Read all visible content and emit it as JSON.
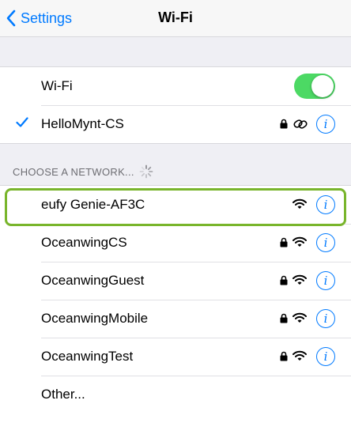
{
  "navbar": {
    "back_label": "Settings",
    "title": "Wi-Fi"
  },
  "wifi_toggle": {
    "label": "Wi-Fi",
    "on": true
  },
  "connected_network": {
    "name": "HelloMynt-CS",
    "icons": [
      "checkmark-icon",
      "lock-icon",
      "link-icon",
      "info-icon"
    ]
  },
  "networks_section": {
    "header": "CHOOSE A NETWORK...",
    "networks": [
      {
        "name": "eufy Genie-AF3C",
        "secured": false,
        "highlighted": true
      },
      {
        "name": "OceanwingCS",
        "secured": true
      },
      {
        "name": "OceanwingGuest",
        "secured": true
      },
      {
        "name": "OceanwingMobile",
        "secured": true
      },
      {
        "name": "OceanwingTest",
        "secured": true
      }
    ],
    "other_label": "Other..."
  },
  "colors": {
    "accent": "#007aff",
    "toggle_on": "#4cd964",
    "highlight_border": "#79b52c"
  }
}
